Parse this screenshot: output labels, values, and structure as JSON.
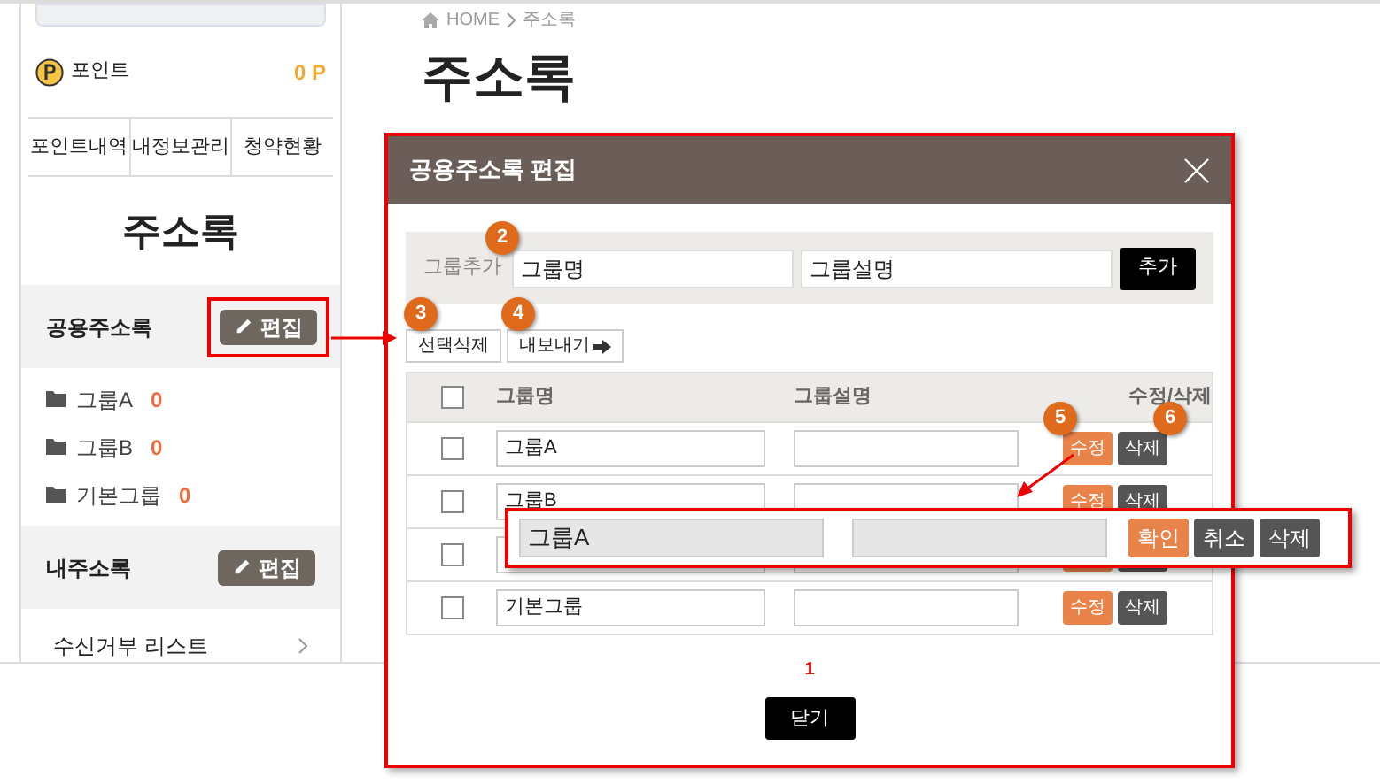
{
  "sidebar": {
    "point": {
      "label": "포인트",
      "value": "0 P"
    },
    "tabs": [
      {
        "label": "포인트내역"
      },
      {
        "label": "내정보관리"
      },
      {
        "label": "청약현황"
      }
    ],
    "title": "주소록",
    "sections": [
      {
        "title": "공용주소록",
        "edit_button": "편집",
        "highlighted": true,
        "groups": [
          {
            "name": "그룹A",
            "count": "0"
          },
          {
            "name": "그룹B",
            "count": "0"
          },
          {
            "name": "기본그룹",
            "count": "0"
          }
        ]
      },
      {
        "title": "내주소록",
        "edit_button": "편집",
        "highlighted": false
      }
    ],
    "link": "수신거부 리스트"
  },
  "breadcrumb": {
    "home": "HOME",
    "current": "주소록"
  },
  "page_title": "주소록",
  "dialog": {
    "title": "공용주소록 편집",
    "add_row": {
      "label": "그룹추가",
      "name_value": "그룹명",
      "desc_value": "그룹설명",
      "button": "추가"
    },
    "toolbar": [
      {
        "label": "선택삭제",
        "kind": "plain"
      },
      {
        "label": "내보내기",
        "kind": "export"
      }
    ],
    "table": {
      "header_checked": false,
      "columns": [
        "그룹명",
        "그룹설명",
        "수정/삭제"
      ],
      "rows": [
        {
          "checked": false,
          "name": "그룹A",
          "edit": "수정",
          "delete": "삭제"
        },
        {
          "checked": false,
          "name": "그룹B",
          "edit": "수정",
          "delete": "삭제"
        },
        {
          "checked": false
        },
        {
          "checked": false,
          "name": "기본그룹",
          "edit": "수정",
          "delete": "삭제"
        }
      ]
    },
    "pagination": [
      {
        "label": "1",
        "selected": true
      }
    ],
    "close_button": "닫기"
  },
  "edit_popup": {
    "name": "그룹A",
    "buttons": [
      {
        "label": "확인",
        "kind": "confirm"
      },
      {
        "label": "취소",
        "kind": "dark"
      },
      {
        "label": "삭제",
        "kind": "dark"
      }
    ]
  },
  "callouts": [
    {
      "number": "2"
    },
    {
      "number": "3"
    },
    {
      "number": "4"
    },
    {
      "number": "5"
    },
    {
      "number": "6"
    }
  ]
}
